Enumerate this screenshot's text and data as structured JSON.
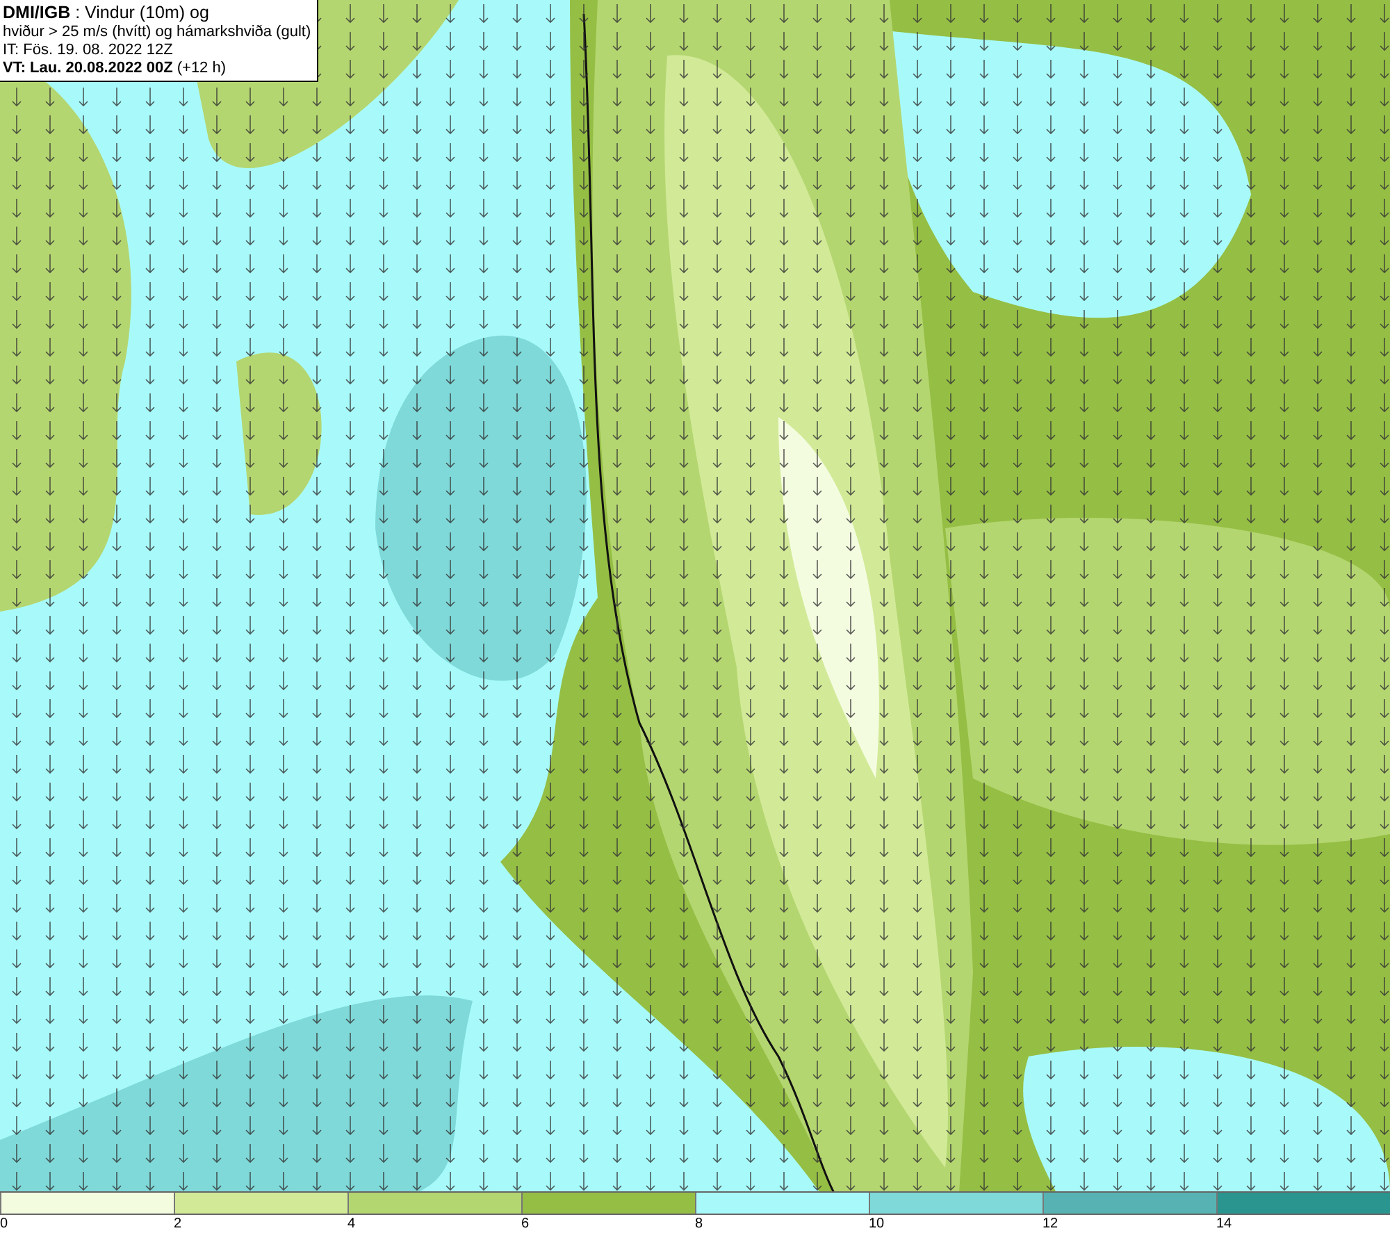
{
  "header": {
    "lines": [
      "**DMI/IGB** : Vindur (10m) og",
      "hviður > 25 m/s (hvítt) og hámarkshviða (gult)",
      "IT: Fös. 19. 08. 2022 12Z",
      "**VT: Lau. 20.08.2022 00Z** (+12 h)"
    ]
  },
  "legend": {
    "bins": [
      {
        "color": "#f4fce0",
        "label": "0"
      },
      {
        "color": "#d2ea98",
        "label": "2"
      },
      {
        "color": "#b4d670",
        "label": "4"
      },
      {
        "color": "#95be44",
        "label": "6"
      },
      {
        "color": "#a8fafa",
        "label": "8"
      },
      {
        "color": "#7fd9d9",
        "label": "10"
      },
      {
        "color": "#57b3b3",
        "label": "12"
      },
      {
        "color": "#2a948e",
        "label": "14"
      }
    ]
  }
}
